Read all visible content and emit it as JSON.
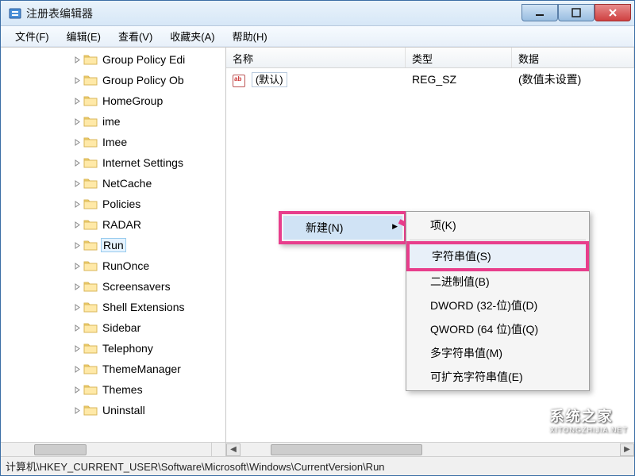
{
  "window": {
    "title": "注册表编辑器"
  },
  "menubar": {
    "items": [
      {
        "label": "文件(F)"
      },
      {
        "label": "编辑(E)"
      },
      {
        "label": "查看(V)"
      },
      {
        "label": "收藏夹(A)"
      },
      {
        "label": "帮助(H)"
      }
    ]
  },
  "tree": {
    "nodes": [
      {
        "label": "Group Policy Edi"
      },
      {
        "label": "Group Policy Ob"
      },
      {
        "label": "HomeGroup"
      },
      {
        "label": "ime"
      },
      {
        "label": "Imee"
      },
      {
        "label": "Internet Settings"
      },
      {
        "label": "NetCache"
      },
      {
        "label": "Policies"
      },
      {
        "label": "RADAR"
      },
      {
        "label": "Run",
        "selected": true
      },
      {
        "label": "RunOnce"
      },
      {
        "label": "Screensavers"
      },
      {
        "label": "Shell Extensions"
      },
      {
        "label": "Sidebar"
      },
      {
        "label": "Telephony"
      },
      {
        "label": "ThemeManager"
      },
      {
        "label": "Themes"
      },
      {
        "label": "Uninstall"
      }
    ]
  },
  "list": {
    "columns": {
      "name": "名称",
      "type": "类型",
      "data": "数据"
    },
    "rows": [
      {
        "name": "(默认)",
        "type": "REG_SZ",
        "data": "(数值未设置)"
      }
    ]
  },
  "context_menu_1": {
    "items": [
      {
        "label": "新建(N)",
        "has_sub": true
      }
    ]
  },
  "context_menu_2": {
    "items": [
      {
        "label": "项(K)"
      },
      {
        "sep": true
      },
      {
        "label": "字符串值(S)",
        "highlighted": true
      },
      {
        "label": "二进制值(B)"
      },
      {
        "label": "DWORD (32-位)值(D)"
      },
      {
        "label": "QWORD (64 位)值(Q)"
      },
      {
        "label": "多字符串值(M)"
      },
      {
        "label": "可扩充字符串值(E)"
      }
    ]
  },
  "statusbar": {
    "path": "计算机\\HKEY_CURRENT_USER\\Software\\Microsoft\\Windows\\CurrentVersion\\Run"
  },
  "watermark": {
    "cn": "系统之家",
    "en": "XITONGZHIJIA.NET"
  },
  "colors": {
    "highlight": "#e83e8c"
  }
}
